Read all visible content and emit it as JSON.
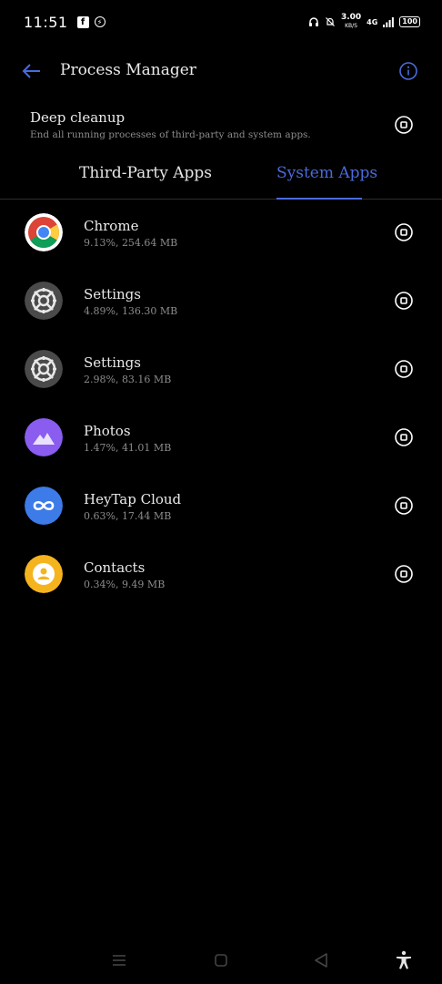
{
  "status_bar": {
    "time": "11:51",
    "speed_value": "3.00",
    "speed_unit": "KB/S",
    "network": "4G",
    "battery": "100"
  },
  "header": {
    "title": "Process Manager",
    "back_icon": "arrow-left-icon",
    "info_icon": "info-icon"
  },
  "deep_cleanup": {
    "title": "Deep cleanup",
    "description": "End all running processes of third-party and system apps."
  },
  "tabs": [
    {
      "label": "Third-Party Apps",
      "active": false
    },
    {
      "label": "System Apps",
      "active": true
    }
  ],
  "apps": [
    {
      "name": "Chrome",
      "stats": "9.13%, 254.64 MB",
      "icon": "chrome-icon"
    },
    {
      "name": "Settings",
      "stats": "4.89%, 136.30 MB",
      "icon": "settings-gear-icon"
    },
    {
      "name": "Settings",
      "stats": "2.98%, 83.16 MB",
      "icon": "settings-gear-icon"
    },
    {
      "name": "Photos",
      "stats": "1.47%, 41.01 MB",
      "icon": "photos-icon"
    },
    {
      "name": "HeyTap Cloud",
      "stats": "0.63%, 17.44 MB",
      "icon": "cloud-infinity-icon"
    },
    {
      "name": "Contacts",
      "stats": "0.34%, 9.49 MB",
      "icon": "contacts-icon"
    }
  ],
  "colors": {
    "accent": "#4a6bdc",
    "background": "#000000",
    "secondary_text": "#8c8c8c",
    "photos": "#8a5cf0",
    "heytap": "#3d7be8",
    "contacts": "#f5b41e",
    "settings": "#4a4a4a"
  }
}
